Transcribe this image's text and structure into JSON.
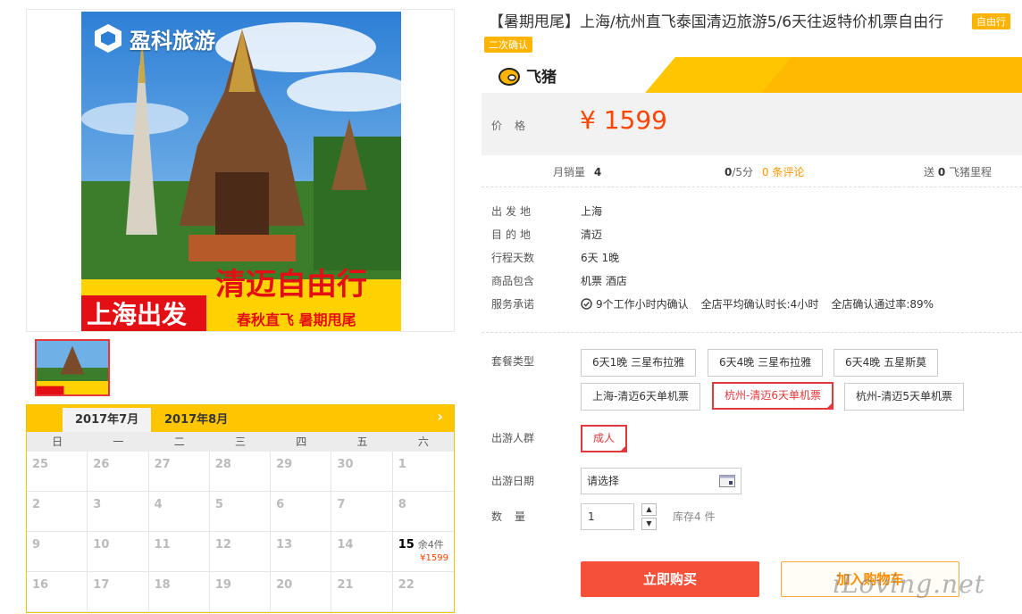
{
  "gallery": {
    "logo_text": "盈科旅游",
    "banner_main": "清迈自由行",
    "banner_origin": "上海出发",
    "banner_sub": "春秋直飞  暑期甩尾"
  },
  "calendar": {
    "month_active": "2017年7月",
    "month_next": "2017年8月",
    "next_icon": "chevron-right-icon",
    "weekdays": [
      "日",
      "一",
      "二",
      "三",
      "四",
      "五",
      "六"
    ],
    "days": [
      {
        "d": "25"
      },
      {
        "d": "26"
      },
      {
        "d": "27"
      },
      {
        "d": "28"
      },
      {
        "d": "29"
      },
      {
        "d": "30"
      },
      {
        "d": "1"
      },
      {
        "d": "2"
      },
      {
        "d": "3"
      },
      {
        "d": "4"
      },
      {
        "d": "5"
      },
      {
        "d": "6"
      },
      {
        "d": "7"
      },
      {
        "d": "8"
      },
      {
        "d": "9"
      },
      {
        "d": "10"
      },
      {
        "d": "11"
      },
      {
        "d": "12"
      },
      {
        "d": "13"
      },
      {
        "d": "14"
      },
      {
        "d": "15",
        "stock": "余4件",
        "price": "¥1599"
      },
      {
        "d": "16"
      },
      {
        "d": "17"
      },
      {
        "d": "18"
      },
      {
        "d": "19"
      },
      {
        "d": "20"
      },
      {
        "d": "21"
      },
      {
        "d": "22"
      }
    ]
  },
  "product": {
    "title": "【暑期甩尾】上海/杭州直飞泰国清迈旅游5/6天往返特价机票自由行",
    "tag_free": "自由行",
    "tag_confirm": "二次确认",
    "brand": "飞猪",
    "price_label": "价格",
    "price": "¥ 1599"
  },
  "stats": {
    "monthly_label": "月销量",
    "monthly_value": "4",
    "rating_value": "0",
    "rating_suffix": "/5分",
    "reviews": "0 条评论",
    "mileage_prefix": "送",
    "mileage_value": "0",
    "mileage_suffix": "飞猪里程"
  },
  "info": {
    "depart_label": "出发地",
    "depart_value": "上海",
    "dest_label": "目的地",
    "dest_value": "清迈",
    "days_label": "行程天数",
    "days_value": "6天 1晚",
    "include_label": "商品包含",
    "include_value": "机票  酒店",
    "service_label": "服务承诺",
    "service_1": "9个工作小时内确认",
    "service_2": "全店平均确认时长:4小时",
    "service_3": "全店确认通过率:89%"
  },
  "options": {
    "package_label": "套餐类型",
    "packages": [
      "6天1晚 三星布拉雅",
      "6天4晚 三星布拉雅",
      "6天4晚 五星斯莫",
      "上海-清迈6天单机票",
      "杭州-清迈6天单机票",
      "杭州-清迈5天单机票"
    ],
    "people_label": "出游人群",
    "people": [
      "成人"
    ],
    "date_label": "出游日期",
    "date_placeholder": "请选择",
    "qty_label": "数量",
    "qty_value": "1",
    "stock_text": "库存4 件"
  },
  "actions": {
    "buy": "立即购买",
    "cart": "加入购物车"
  },
  "watermark": "iLoving.net",
  "colors": {
    "accent_red": "#f5513a",
    "brand_yellow": "#ffc600",
    "price_orange": "#ff4400",
    "select_red": "#e4393c"
  }
}
